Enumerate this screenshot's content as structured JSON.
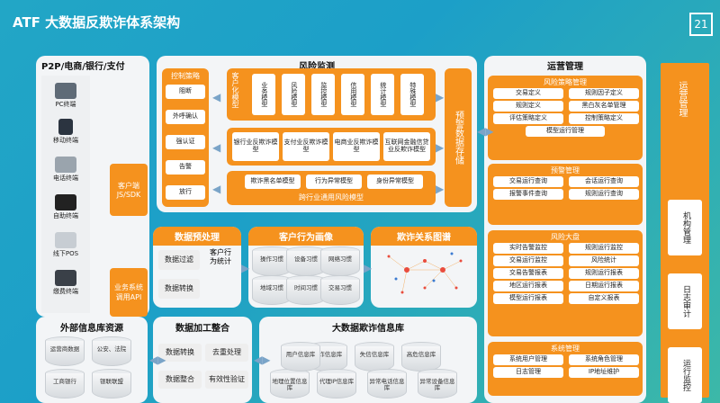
{
  "title": "ATF 大数据反欺诈体系架构",
  "page_number": "21",
  "left_panel": {
    "title": "P2P/电商/银行/支付",
    "devices": [
      "PC终端",
      "移动终端",
      "电话终端",
      "自助终端",
      "线下POS",
      "缴费终端"
    ],
    "client": "客户端\nJS/SDK",
    "api": "业务系统\n调用API"
  },
  "risk_monitor": {
    "title": "风险监测",
    "strategy_title": "控制策略",
    "strategies": [
      "阻断",
      "外呼确认",
      "强认证",
      "告警",
      "放行"
    ],
    "customer_model": "客户化模型",
    "biz_models": [
      "业务模型",
      "风险模型",
      "监控模型",
      "信用模型",
      "统计模型",
      "特殊模型"
    ],
    "fraud_models": [
      "银行业反欺诈模型",
      "支付业反欺诈模型",
      "电商业反欺诈模型",
      "互联网金融信贷业反欺诈模型"
    ],
    "cross_models": [
      "欺诈黑名单模型",
      "行为异常模型",
      "身份异常模型"
    ],
    "cross_title": "跨行业通用风险模型",
    "warning_storage": "预警数据存储"
  },
  "ops": {
    "title": "运营管理",
    "groups": [
      {
        "title": "风险策略管理",
        "items": [
          "交易定义",
          "规则因子定义",
          "规则定义",
          "黑白灰名单管理",
          "评估策略定义",
          "控制策略定义",
          "模型运行管理"
        ]
      },
      {
        "title": "预警管理",
        "items": [
          "交易运行查询",
          "会话运行查询",
          "报警事件查询",
          "规则运行查询"
        ]
      },
      {
        "title": "风险大盘",
        "items": [
          "实时告警监控",
          "规则运行监控",
          "交易运行监控",
          "风险统计",
          "交易告警报表",
          "规则运行报表",
          "地区运行报表",
          "日期运行报表",
          "模型运行报表",
          "自定义报表"
        ]
      },
      {
        "title": "系统管理",
        "items": [
          "系统用户管理",
          "系统角色管理",
          "日志管理",
          "IP地址维护"
        ]
      }
    ]
  },
  "right_side": {
    "title": "运营管理",
    "items": [
      "机构管理",
      "日志审计",
      "运行监控"
    ]
  },
  "preprocess": {
    "title": "数据预处理",
    "items": [
      "数据过滤",
      "数据转换"
    ],
    "stat": "客户行为统计"
  },
  "behavior": {
    "title": "客户行为画像",
    "items": [
      "操作习惯",
      "设备习惯",
      "网络习惯",
      "地域习惯",
      "时间习惯",
      "交易习惯"
    ]
  },
  "graph": {
    "title": "欺诈关系图谱"
  },
  "external": {
    "title": "外部信息库资源",
    "items": [
      "运营商数据",
      "公安、法院",
      "工商银行",
      "银联联盟"
    ]
  },
  "processing": {
    "title": "数据加工整合",
    "items": [
      "数据转换",
      "去重处理",
      "数据整合",
      "有效性验证"
    ]
  },
  "bigdata": {
    "title": "大数据欺诈信息库",
    "items": [
      "欺诈信息库",
      "失信信息库",
      "高危信息库",
      "地理位置信息库",
      "代理IP信息库",
      "异常电话信息库",
      "异常设备信息库",
      "用户信息库"
    ]
  },
  "colors": {
    "accent": "#f5921e",
    "panel": "#f3f5f7",
    "bg": "#22a6c6"
  }
}
